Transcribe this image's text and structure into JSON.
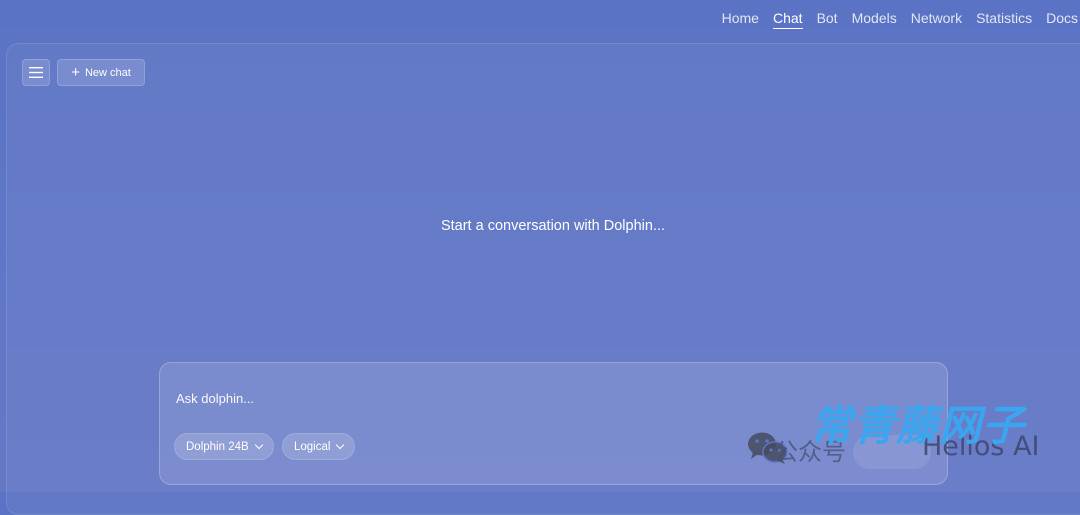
{
  "nav": {
    "items": [
      {
        "label": "Home"
      },
      {
        "label": "Chat",
        "active": true
      },
      {
        "label": "Bot"
      },
      {
        "label": "Models"
      },
      {
        "label": "Network"
      },
      {
        "label": "Statistics"
      },
      {
        "label": "Docs"
      }
    ]
  },
  "sidebar_toggle": {
    "icon": "menu-icon"
  },
  "new_chat": {
    "label": "New chat",
    "icon": "plus-icon"
  },
  "empty_state": {
    "text": "Start a conversation with Dolphin..."
  },
  "composer": {
    "placeholder": "Ask dolphin...",
    "model_select": {
      "label": "Dolphin 24B"
    },
    "mode_select": {
      "label": "Logical"
    }
  },
  "watermark": {
    "label_gray": "公众号",
    "label_cjk": "常青藤网子",
    "label_latin": "Hellos AI",
    "icon": "wechat-icon"
  },
  "colors": {
    "background": "#5b74c5",
    "accent_watermark": "#3aa6ef"
  }
}
